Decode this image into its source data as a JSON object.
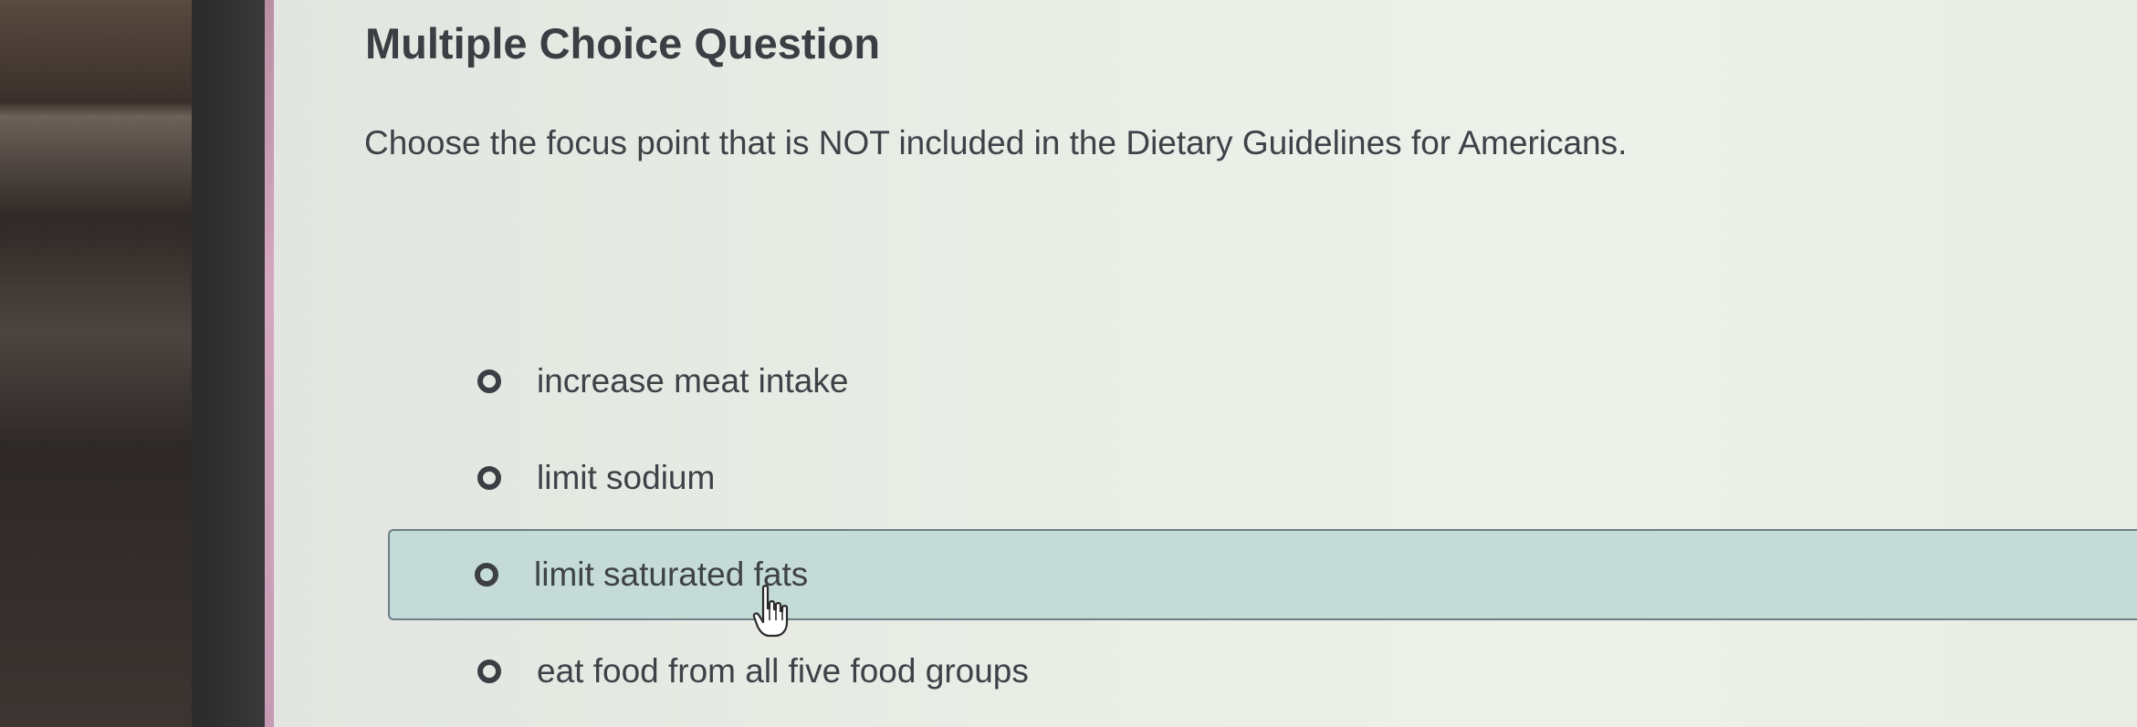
{
  "question": {
    "heading": "Multiple Choice Question",
    "prompt": "Choose the focus point that is NOT included in the Dietary Guidelines for Americans."
  },
  "options": [
    {
      "label": "increase meat intake",
      "hovered": false
    },
    {
      "label": "limit sodium",
      "hovered": false
    },
    {
      "label": "limit saturated fats",
      "hovered": true
    },
    {
      "label": "eat food from all five food groups",
      "hovered": false
    }
  ],
  "colors": {
    "hover_fill": "#c4dbd8",
    "hover_border": "#6b7f86",
    "text": "#3e4247"
  },
  "icons": {
    "radio": "radio-unselected-icon",
    "cursor": "hand-pointer-cursor-icon"
  }
}
